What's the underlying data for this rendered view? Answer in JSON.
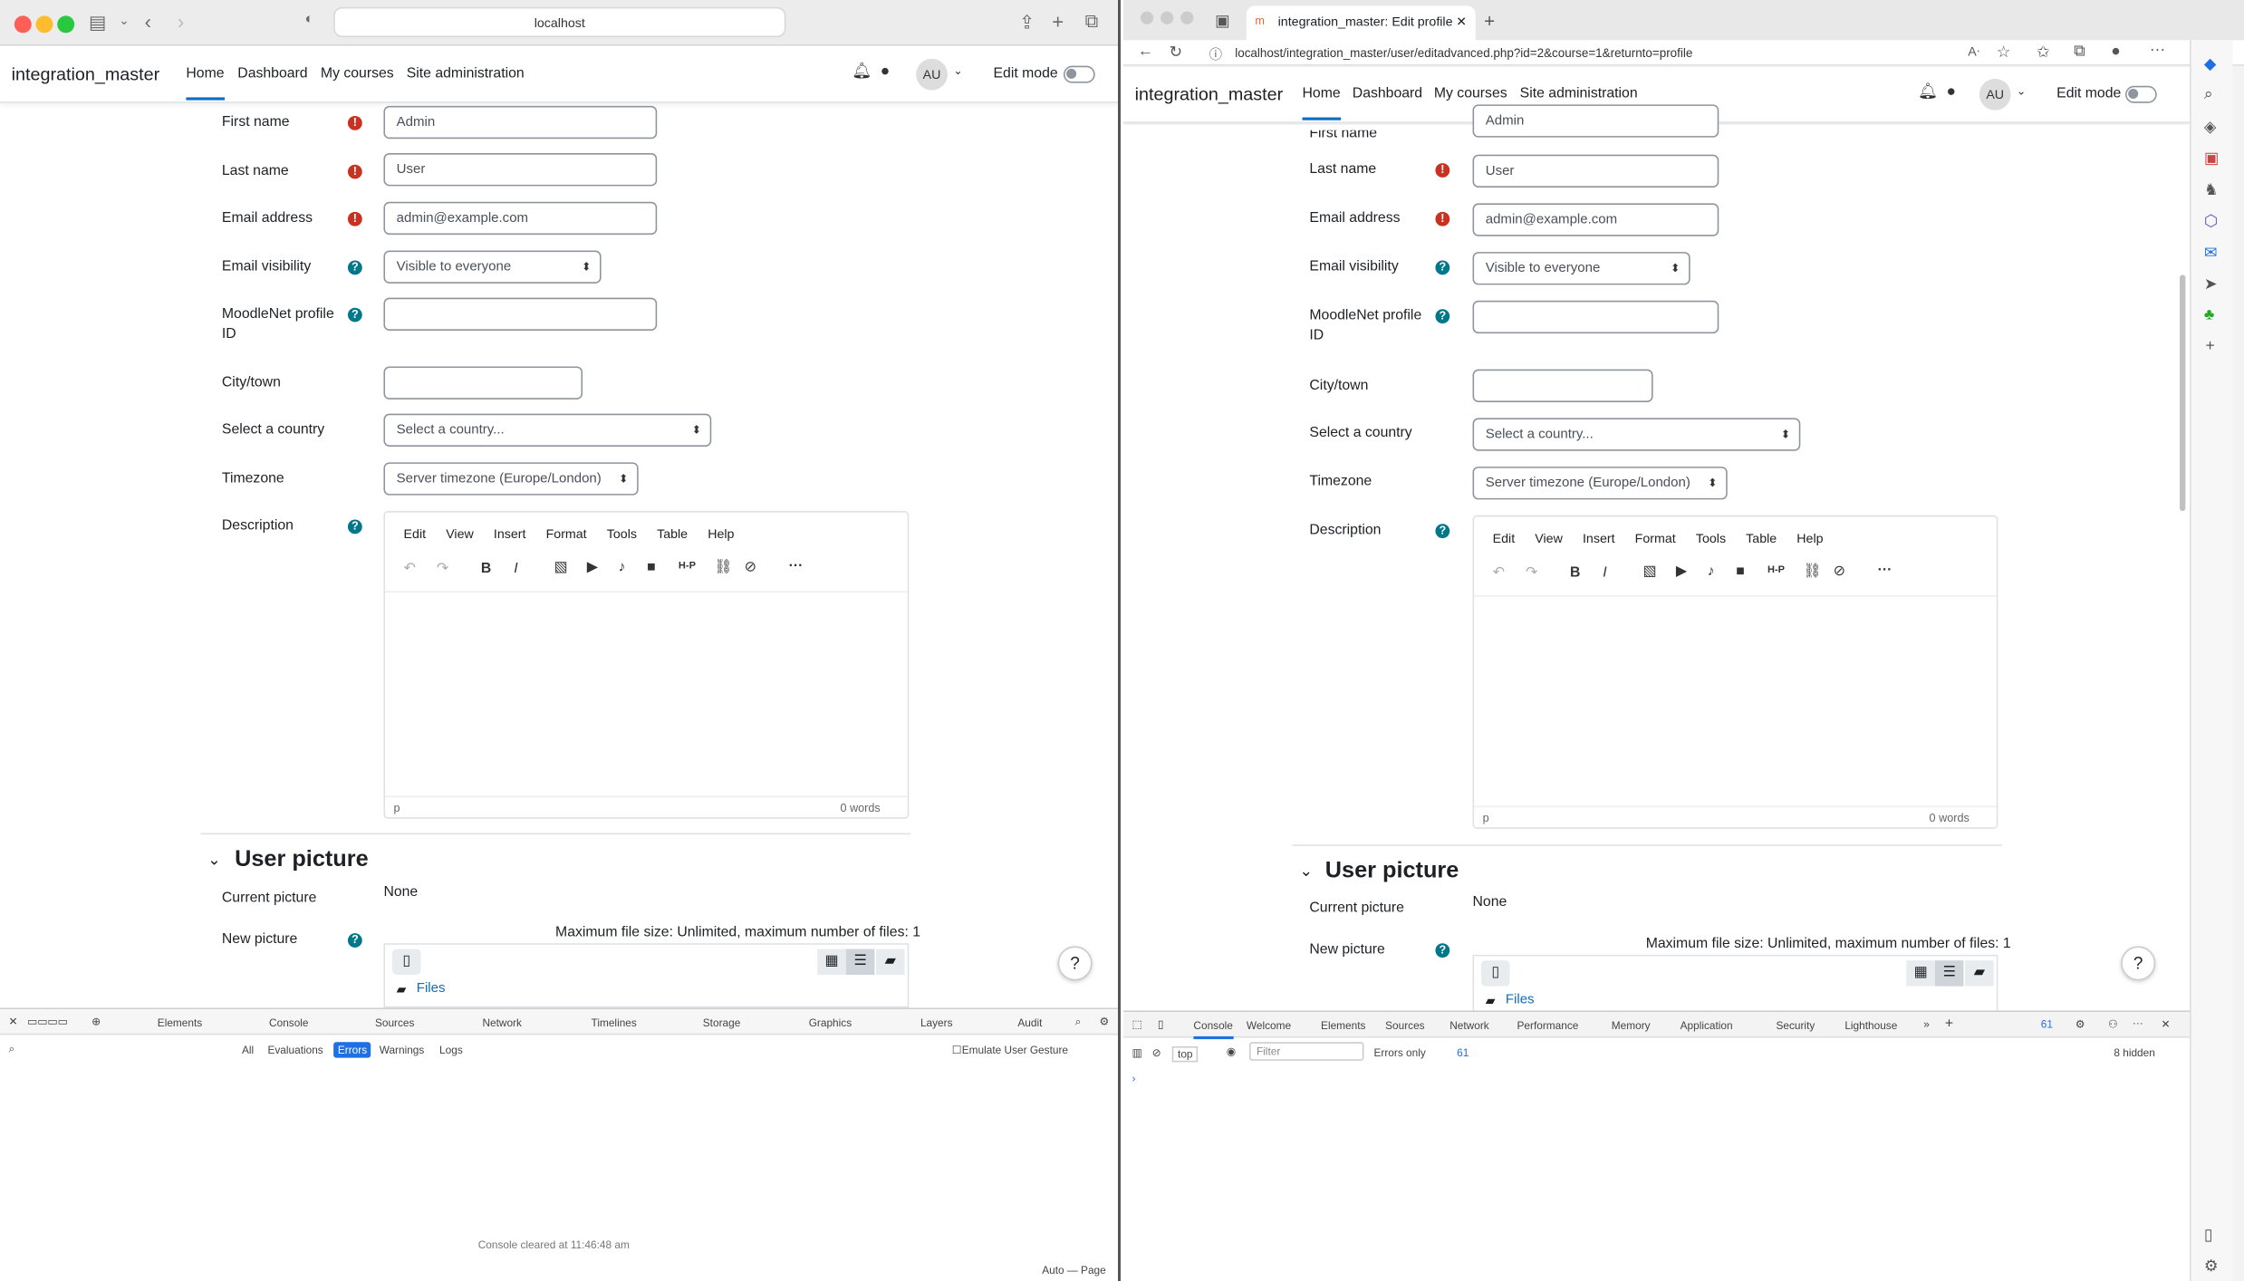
{
  "safari": {
    "url": "localhost"
  },
  "edge": {
    "tab_title": "integration_master: Edit profile",
    "url": "localhost/integration_master/user/editadvanced.php?id=2&course=1&returnto=profile"
  },
  "moodle": {
    "brand": "integration_master",
    "nav": [
      "Home",
      "Dashboard",
      "My courses",
      "Site administration"
    ],
    "avatar": "AU",
    "edit_mode": "Edit mode"
  },
  "form": {
    "first_name_label": "First name",
    "first_name": "Admin",
    "last_name_label": "Last name",
    "last_name": "User",
    "email_label": "Email address",
    "email": "admin@example.com",
    "email_visibility_label": "Email visibility",
    "email_visibility": "Visible to everyone",
    "moodlenet_label_1": "MoodleNet profile",
    "moodlenet_label_2": "ID",
    "city_label": "City/town",
    "country_label": "Select a country",
    "country": "Select a country...",
    "timezone_label": "Timezone",
    "timezone": "Server timezone (Europe/London)",
    "description_label": "Description",
    "editor_menu": [
      "Edit",
      "View",
      "Insert",
      "Format",
      "Tools",
      "Table",
      "Help"
    ],
    "editor_path": "p",
    "word_count": "0 words"
  },
  "picture": {
    "heading": "User picture",
    "current_label": "Current picture",
    "current": "None",
    "new_label": "New picture",
    "max_size": "Maximum file size: Unlimited, maximum number of files: 1",
    "files": "Files"
  },
  "safari_devtools": {
    "tabs": [
      "Elements",
      "Console",
      "Sources",
      "Network",
      "Timelines",
      "Storage",
      "Graphics",
      "Layers",
      "Audit"
    ],
    "filters": [
      "All",
      "Evaluations",
      "Errors",
      "Warnings",
      "Logs"
    ],
    "emulate": "Emulate User Gesture",
    "cleared": "Console cleared at 11:46:48 am",
    "footer": "Auto — Page"
  },
  "edge_devtools": {
    "tabs": [
      "Console",
      "Welcome",
      "Elements",
      "Sources",
      "Network",
      "Performance",
      "Memory",
      "Application",
      "Security",
      "Lighthouse"
    ],
    "context": "top",
    "filter_placeholder": "Filter",
    "level": "Errors only",
    "issues": "61",
    "hidden": "8 hidden"
  },
  "colors": {
    "required": "#ca3120",
    "help": "#00788a",
    "link": "#0f6cbf",
    "errors_filter": "#1f6fe5"
  }
}
